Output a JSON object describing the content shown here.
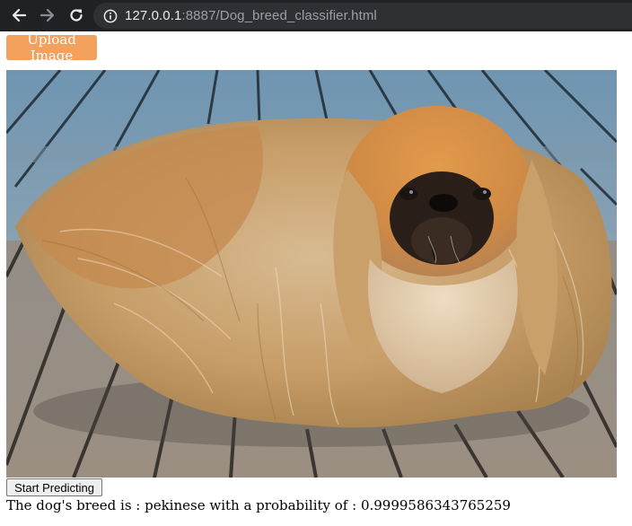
{
  "browser": {
    "url_host": "127.0.0.1",
    "url_rest": ":8887/Dog_breed_classifier.html",
    "icons": [
      "back-arrow-icon",
      "forward-arrow-icon",
      "reload-icon",
      "info-icon"
    ]
  },
  "page": {
    "upload_label": "Upload Image",
    "image": {
      "subject": "photo-of-pekingese-dog-on-wooden-deck"
    },
    "predict_label": "Start Predicting",
    "result_text": "The dog's breed is : pekinese with a probability of : 0.9999586343765259"
  },
  "colors": {
    "chrome_bg": "#202124",
    "omnibox_bg": "#2f3033",
    "upload_button": "#f4a15d"
  }
}
